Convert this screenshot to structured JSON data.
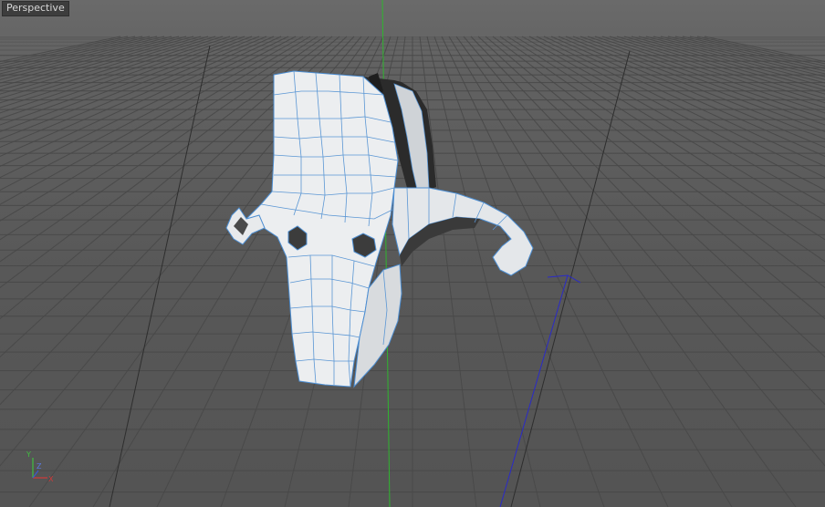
{
  "viewport": {
    "label": "Perspective",
    "background_color": "#5b5b5b",
    "grid_color": "#4a4a4a",
    "mesh_color": "#e9ecef",
    "wire_color": "#4f8fd0"
  },
  "axes": {
    "x_label": "X",
    "y_label": "Y",
    "z_label": "Z",
    "x_color": "#d03a3a",
    "y_color": "#3fc03f",
    "z_color": "#3a5ad0"
  }
}
